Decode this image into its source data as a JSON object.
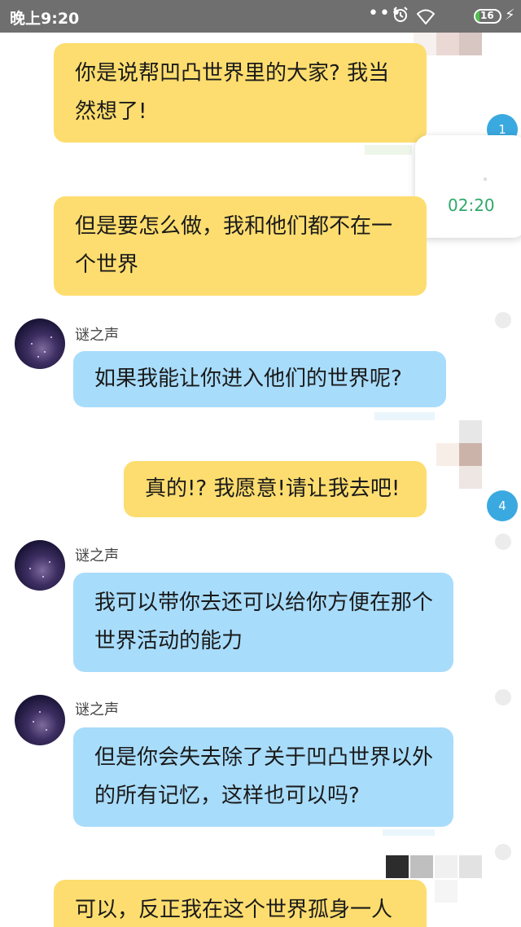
{
  "status_bar": {
    "time": "晚上9:20",
    "dots": "•••",
    "battery_level": "16",
    "battery_fraction": 0.16,
    "bolt": "⚡"
  },
  "floating_call": {
    "badge_count": "1",
    "timer": "02:20"
  },
  "side_badge_2": "4",
  "messages": [
    {
      "from": "me",
      "text": "你是说帮凹凸世界里的大家? 我当然想了!"
    },
    {
      "from": "me",
      "text": "但是要怎么做，我和他们都不在一个世界"
    },
    {
      "from": "other",
      "sender": "谜之声",
      "text": "如果我能让你进入他们的世界呢?"
    },
    {
      "from": "me",
      "text": "真的!? 我愿意!请让我去吧!"
    },
    {
      "from": "other",
      "sender": "谜之声",
      "text": "我可以带你去还可以给你方便在那个世界活动的能力"
    },
    {
      "from": "other",
      "sender": "谜之声",
      "text": "但是你会失去除了关于凹凸世界以外的所有记忆，这样也可以吗?"
    },
    {
      "from": "me",
      "text": "可以，反正我在这个世界孤身一人"
    }
  ],
  "colors": {
    "status_bar_bg": "#6f6f6f",
    "my_bubble": "#fddd6f",
    "other_bubble": "#a8dcfb",
    "badge": "#3aa9e0",
    "timer_text": "#2fa86a"
  },
  "icons": {
    "alarm": "alarm-icon",
    "wifi": "wifi-icon",
    "battery": "battery-icon",
    "charging": "charging-bolt-icon"
  }
}
